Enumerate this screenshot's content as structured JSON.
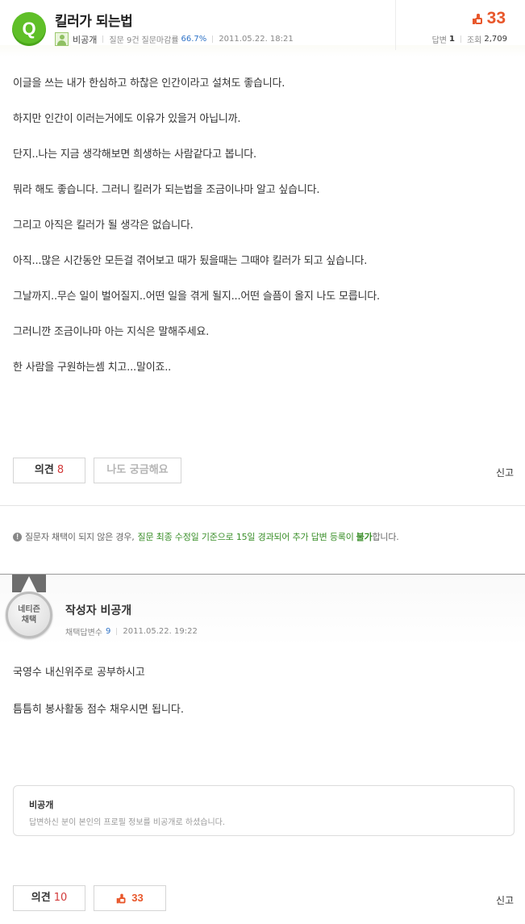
{
  "question": {
    "badge": "Q",
    "title": "킬러가 되는법",
    "author": "비공개",
    "question_count": "질문 9건",
    "close_rate_label": "질문마감률",
    "close_rate": "66.7%",
    "date": "2011.05.22. 18:21",
    "likes": "33",
    "answers_label": "답변",
    "answers": "1",
    "views_label": "조회",
    "views": "2,709",
    "body": [
      "이글을 쓰는 내가 한심하고 하찮은 인간이라고 설쳐도 좋습니다.",
      "하지만 인간이 이러는거에도 이유가 있을거 아닙니까.",
      "단지..나는 지금 생각해보면 희생하는 사람같다고 봅니다.",
      "뭐라 해도 좋습니다. 그러니 킬러가 되는법을 조금이나마 알고 싶습니다.",
      "그리고 아직은 킬러가 될 생각은 없습니다.",
      "아직...많은 시간동안 모든걸 겪어보고 때가 됬을때는 그때야 킬러가 되고 싶습니다.",
      "그날까지..무슨 일이 벌어질지..어떤 일을 겪게 될지...어떤 슬픔이 올지 나도 모릅니다.",
      "그러니깐 조금이나마 아는 지식은 말해주세요.",
      "한 사람을 구원하는셈 치고...말이죠.."
    ],
    "opinion_label": "의견",
    "opinion_count": "8",
    "curious_label": "나도 궁금해요",
    "report_label": "신고"
  },
  "notice": {
    "prefix": "질문자 채택이 되지 않은 경우,",
    "highlight": "질문 최종 수정일 기준으로 15일 경과되어 추가 답변 등록이",
    "bold": "불가",
    "suffix": "합니다."
  },
  "answer": {
    "medal_line1": "네티즌",
    "medal_line2": "채택",
    "author": "작성자 비공개",
    "adopted_label": "채택답변수",
    "adopted_count": "9",
    "date": "2011.05.22. 19:22",
    "body": [
      "국영수 내신위주로 공부하시고",
      "틈틈히 봉사활동 점수 채우시면 됩니다."
    ],
    "profile_name": "비공개",
    "profile_desc": "답변하신 분이 본인의 프로필 정보를 비공개로 하셨습니다.",
    "opinion_label": "의견",
    "opinion_count": "10",
    "likes": "33",
    "report_label": "신고"
  },
  "colors": {
    "q_badge": "#5fbf28",
    "like": "#e8572b",
    "link_blue": "#2f73c7",
    "count_red": "#d23a3a",
    "notice_green": "#3a8f2a"
  }
}
